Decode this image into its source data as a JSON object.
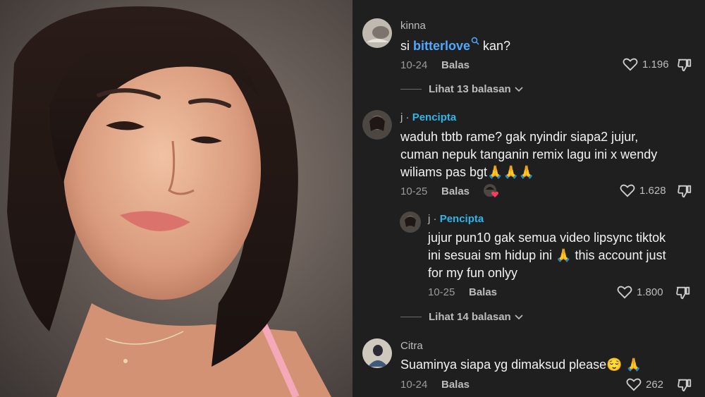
{
  "comments": [
    {
      "username": "kinna",
      "text_prefix": "si ",
      "mention": "bitterlove",
      "text_suffix": " kan?",
      "date": "10-24",
      "reply_label": "Balas",
      "likes": "1.196",
      "view_replies": "Lihat 13 balasan"
    },
    {
      "username": "j",
      "separator": "·",
      "badge": "Pencipta",
      "lines": [
        "waduh tbtb rame? gak nyindir siapa2 jujur,",
        "cuman nepuk tanganin remix lagu ini x wendy",
        "wiliams pas bgt🙏🙏🙏"
      ],
      "date": "10-25",
      "reply_label": "Balas",
      "likes": "1.628"
    },
    {
      "username": "j",
      "separator": "·",
      "badge": "Pencipta",
      "lines": [
        "jujur pun10 gak semua video lipsync tiktok",
        "ini sesuai sm hidup ini 🙏 this account just",
        "for my fun onlyy"
      ],
      "date": "10-25",
      "reply_label": "Balas",
      "likes": "1.800",
      "view_replies": "Lihat 14 balasan"
    },
    {
      "username": "Citra",
      "text": "Suaminya siapa yg dimaksud please😌 🙏",
      "date": "10-24",
      "reply_label": "Balas",
      "likes": "262"
    }
  ],
  "colors": {
    "panel_bg": "#1f1f1f",
    "creator_badge": "#2fb5e8",
    "mention": "#52a7ff"
  },
  "icons": [
    "heart-icon",
    "dislike-icon",
    "chevron-down-icon",
    "search-icon"
  ]
}
